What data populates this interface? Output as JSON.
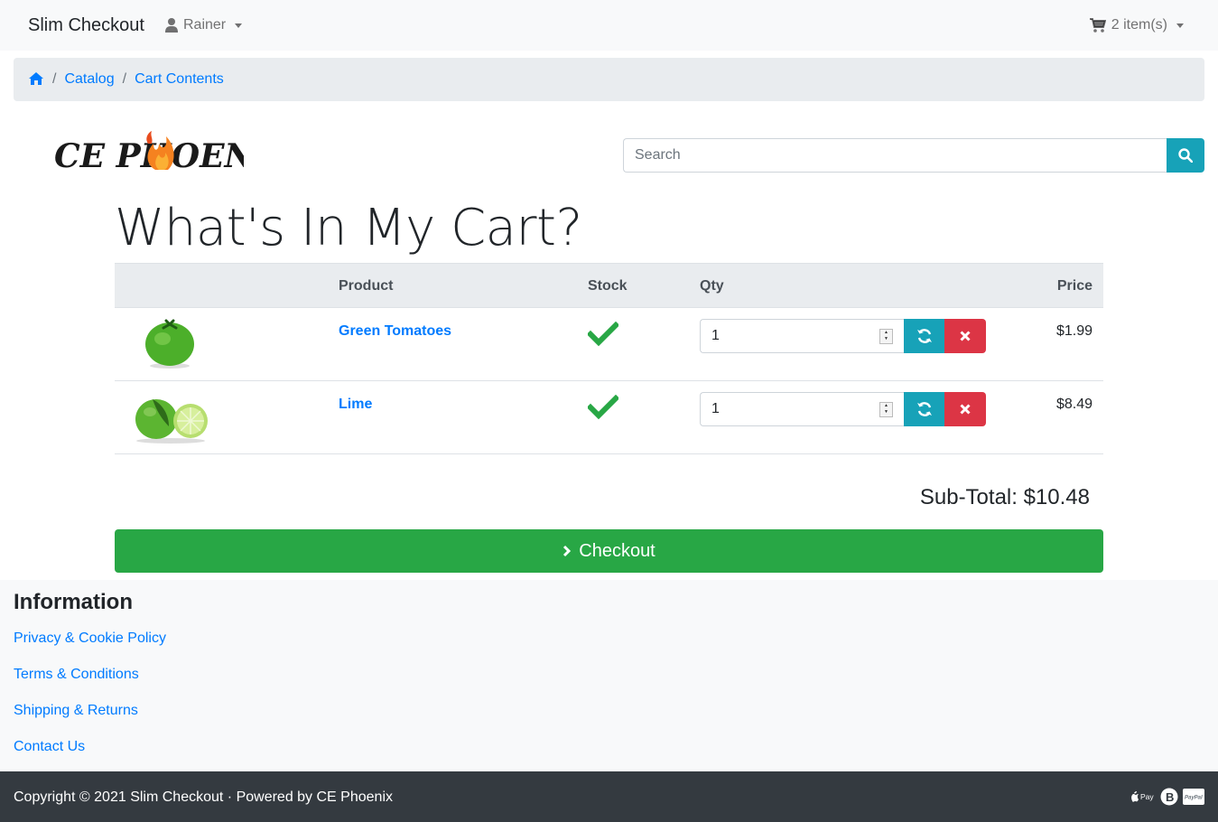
{
  "navbar": {
    "brand": "Slim Checkout",
    "user": "Rainer",
    "cart": "2 item(s)"
  },
  "breadcrumb": {
    "items": [
      "Catalog",
      "Cart Contents"
    ]
  },
  "logo": {
    "text": "CE PHOENIX"
  },
  "search": {
    "placeholder": "Search"
  },
  "page": {
    "title": "What's In My Cart?"
  },
  "cart": {
    "headers": {
      "product": "Product",
      "stock": "Stock",
      "qty": "Qty",
      "price": "Price"
    },
    "items": [
      {
        "name": "Green Tomatoes",
        "qty": "1",
        "price": "$1.99",
        "in_stock": true
      },
      {
        "name": "Lime",
        "qty": "1",
        "price": "$8.49",
        "in_stock": true
      }
    ],
    "subtotal": "Sub-Total: $10.48",
    "checkout_label": "Checkout"
  },
  "information": {
    "title": "Information",
    "links": [
      "Privacy & Cookie Policy",
      "Terms & Conditions",
      "Shipping & Returns",
      "Contact Us"
    ]
  },
  "footer": {
    "copyright": "Copyright © 2021 Slim Checkout · Powered by CE Phoenix",
    "payment_icons": [
      "apple-pay-icon",
      "bitcoin-icon",
      "paypal-icon"
    ]
  },
  "colors": {
    "primary": "#007bff",
    "info": "#17a2b8",
    "danger": "#dc3545",
    "success": "#28a745",
    "dark": "#343a40"
  }
}
